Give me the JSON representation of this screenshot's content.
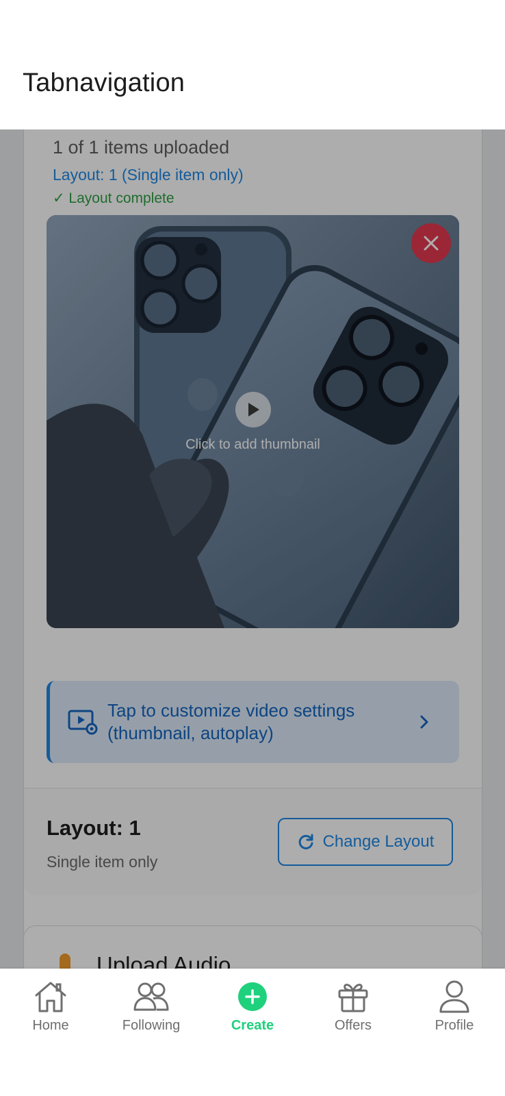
{
  "header": {
    "title": "Tabnavigation"
  },
  "upload_card": {
    "count_text": "1 of 1 items uploaded",
    "layout_text": "Layout: 1 (Single item only)",
    "complete_text": "✓ Layout complete",
    "thumbnail_label": "Click to add thumbnail",
    "settings_banner_text": "Tap to customize video settings (thumbnail, autoplay)",
    "footer_title": "Layout: 1",
    "footer_subtitle": "Single item only",
    "change_layout_label": "Change Layout"
  },
  "audio_card": {
    "title": "Upload Audio"
  },
  "tabs": [
    {
      "label": "Home",
      "icon": "home-icon",
      "active": false
    },
    {
      "label": "Following",
      "icon": "people-icon",
      "active": false
    },
    {
      "label": "Create",
      "icon": "plus-circle-icon",
      "active": true
    },
    {
      "label": "Offers",
      "icon": "gift-icon",
      "active": false
    },
    {
      "label": "Profile",
      "icon": "person-icon",
      "active": false
    }
  ],
  "colors": {
    "accent_blue": "#1e88e5",
    "success_green": "#2e9f43",
    "active_tab": "#1fd17c",
    "remove_red": "#e53950"
  }
}
